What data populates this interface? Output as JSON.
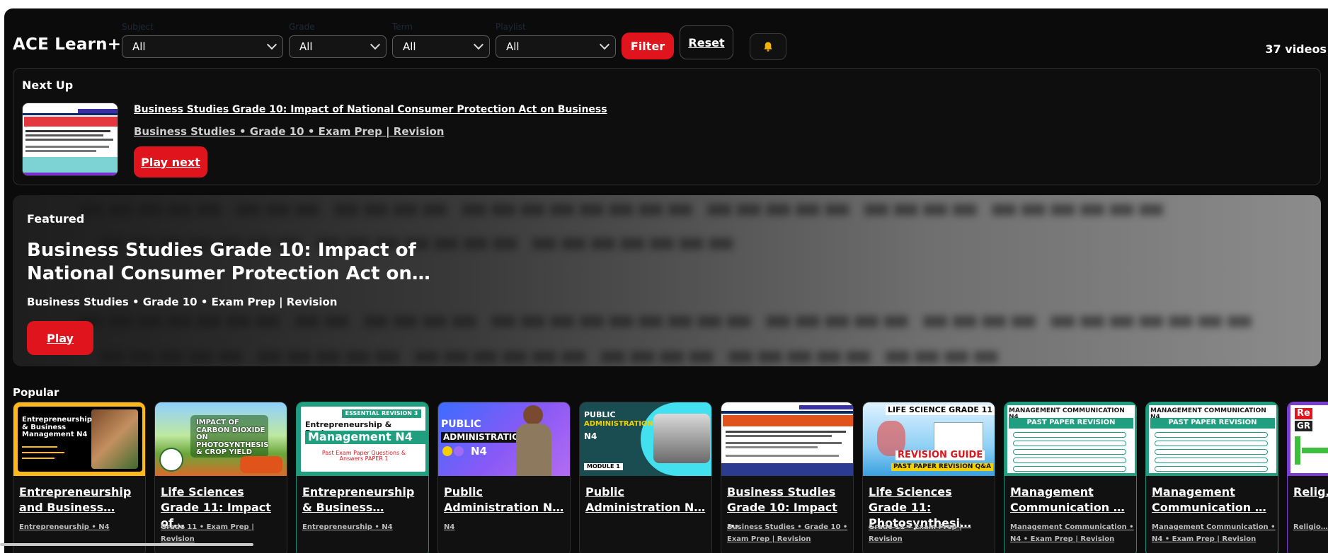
{
  "app": {
    "brand": "ACE Learn+",
    "video_count": "37 videos"
  },
  "filters": [
    {
      "label": "Subject",
      "value": "All"
    },
    {
      "label": "Grade",
      "value": "All"
    },
    {
      "label": "Term",
      "value": "All"
    },
    {
      "label": "Playlist",
      "value": "All"
    }
  ],
  "toolbar": {
    "filter_label": "Filter",
    "reset_label": "Reset",
    "bell_icon": "bell-icon"
  },
  "next_up": {
    "heading": "Next Up",
    "title": "Business Studies Grade 10: Impact of National Consumer Protection Act on Business",
    "meta": "Business Studies • Grade 10 • Exam Prep | Revision",
    "play_label": "Play next"
  },
  "featured": {
    "label": "Featured",
    "title": "Business Studies Grade 10: Impact of National Consumer Protection Act on…",
    "meta": "Business Studies • Grade 10 • Exam Prep | Revision",
    "play_label": "Play"
  },
  "popular": {
    "heading": "Popular",
    "cards": [
      {
        "title": "Entrepreneurship and Business…",
        "meta": "Entrepreneurship • N4",
        "art": [
          "Entrepreneurship & Business Management N4"
        ]
      },
      {
        "title": "Life Sciences Grade 11: Impact of…",
        "meta": "Grade 11 • Exam Prep | Revision",
        "art": [
          "IMPACT OF CARBON DIOXIDE ON PHOTOSYNTHESIS & CROP YIELD"
        ]
      },
      {
        "title": "Entrepreneurship & Business…",
        "meta": "Entrepreneurship • N4",
        "art": [
          "ESSENTIAL REVISION 3",
          "Entrepreneurship & Business",
          "Management N4",
          "Past Exam Paper Questions & Answers PAPER 1"
        ]
      },
      {
        "title": "Public Administration N…",
        "meta": "N4",
        "art": [
          "PUBLIC",
          "ADMINISTRATION",
          "N4"
        ]
      },
      {
        "title": "Public Administration N…",
        "meta": "",
        "art": [
          "PUBLIC",
          "ADMINISTRATION",
          "N4",
          "MODULE 1"
        ]
      },
      {
        "title": "Business Studies Grade 10: Impact …",
        "meta": "Business Studies • Grade 10 • Exam Prep | Revision",
        "art": []
      },
      {
        "title": "Life Sciences Grade 11: Photosynthesi…",
        "meta": "Grade 11 • Exam Prep | Revision",
        "art": [
          "LIFE SCIENCE GRADE 11",
          "REVISION GUIDE",
          "PAST PAPER REVISION Q&A"
        ]
      },
      {
        "title": "Management Communication …",
        "meta": "Management Communication • N4 • Exam Prep | Revision",
        "art": [
          "MANAGEMENT COMMUNICATION N4",
          "PAST PAPER REVISION"
        ]
      },
      {
        "title": "Management Communication …",
        "meta": "Management Communication • N4 • Exam Prep | Revision",
        "art": [
          "MANAGEMENT COMMUNICATION N4",
          "PAST PAPER REVISION"
        ]
      },
      {
        "title": "Relig… Grad…",
        "meta": "Religio… Exam P…",
        "art": [
          "Re",
          "GR"
        ]
      }
    ]
  },
  "colors": {
    "accent": "#e0141c",
    "background": "#0b0b0c",
    "card_border": "#2e2e2e"
  }
}
